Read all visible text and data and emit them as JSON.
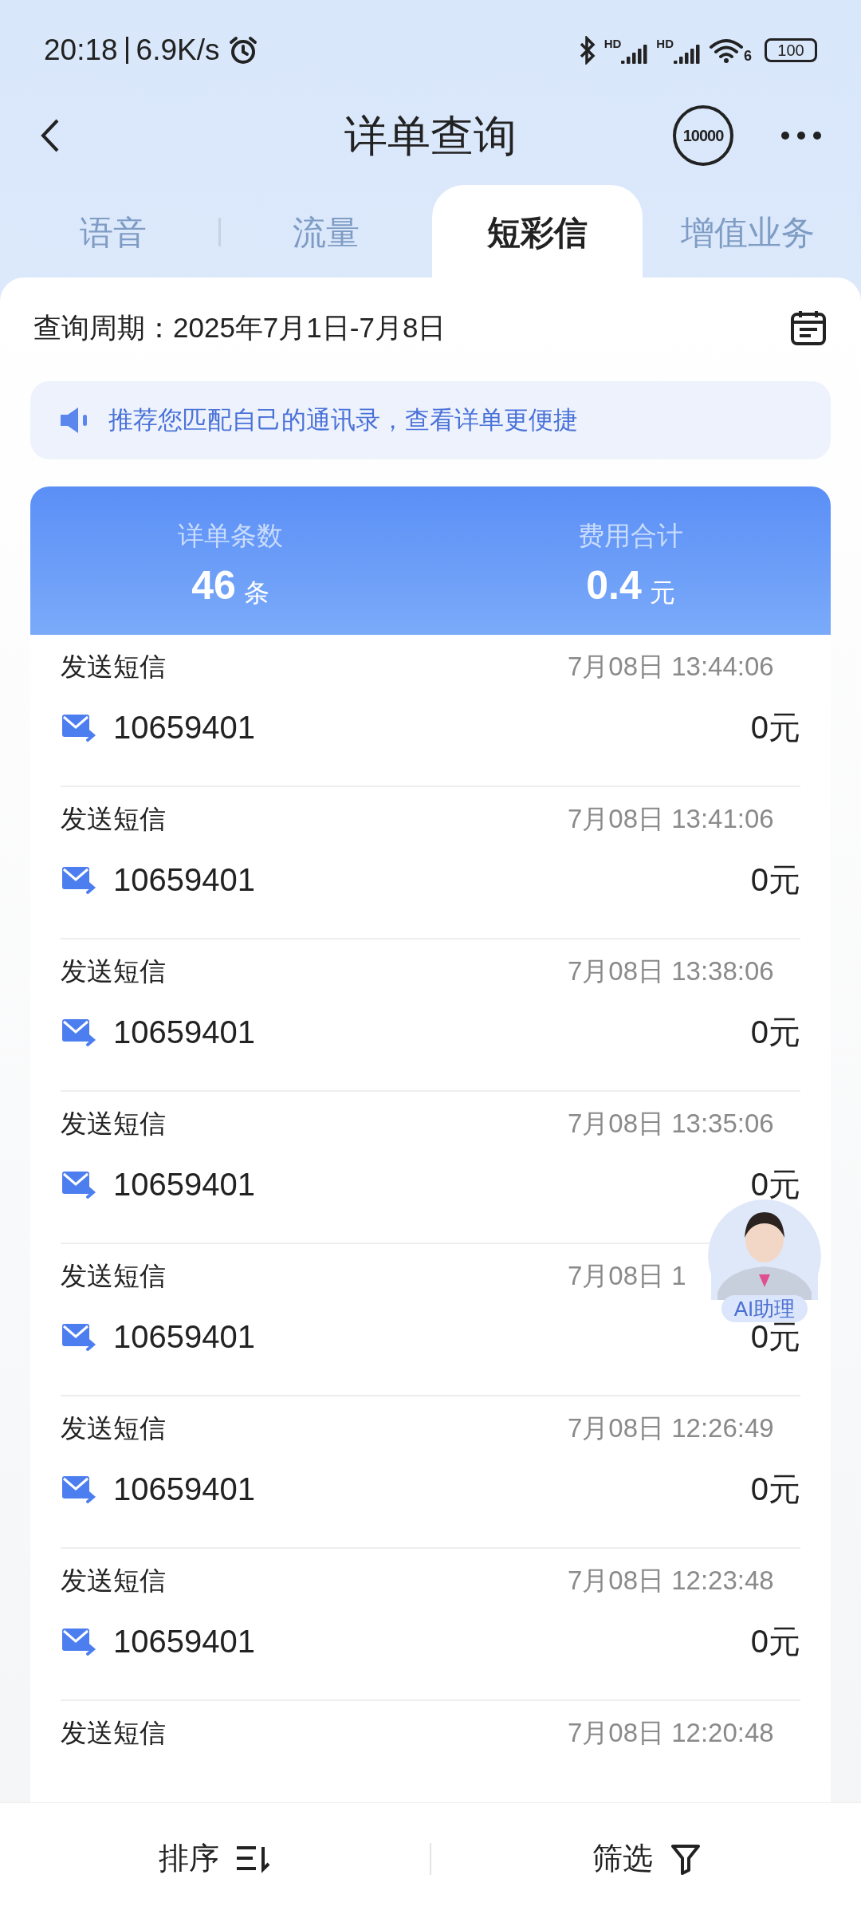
{
  "status_bar": {
    "time": "20:18",
    "speed": "6.9K/s",
    "network_labels": [
      "HD",
      "HD"
    ],
    "wifi_label": "6",
    "battery": "100"
  },
  "header": {
    "title": "详单查询",
    "service_badge": "10000"
  },
  "tabs": [
    {
      "label": "语音",
      "selected": false
    },
    {
      "label": "流量",
      "selected": false
    },
    {
      "label": "短彩信",
      "selected": true
    },
    {
      "label": "增值业务",
      "selected": false
    }
  ],
  "period": {
    "label": "查询周期：",
    "value": "2025年7月1日-7月8日"
  },
  "notice": "推荐您匹配自己的通讯录，查看详单更便捷",
  "summary": [
    {
      "label": "详单条数",
      "value": "46",
      "unit": "条"
    },
    {
      "label": "费用合计",
      "value": "0.4",
      "unit": "元"
    }
  ],
  "records": [
    {
      "type": "发送短信",
      "time": "7月08日 13:44:06",
      "number": "10659401",
      "fee": "0元"
    },
    {
      "type": "发送短信",
      "time": "7月08日 13:41:06",
      "number": "10659401",
      "fee": "0元"
    },
    {
      "type": "发送短信",
      "time": "7月08日 13:38:06",
      "number": "10659401",
      "fee": "0元"
    },
    {
      "type": "发送短信",
      "time": "7月08日 13:35:06",
      "number": "10659401",
      "fee": "0元"
    },
    {
      "type": "发送短信",
      "time": "7月08日 1",
      "number": "10659401",
      "fee": "0元"
    },
    {
      "type": "发送短信",
      "time": "7月08日 12:26:49",
      "number": "10659401",
      "fee": "0元"
    },
    {
      "type": "发送短信",
      "time": "7月08日 12:23:48",
      "number": "10659401",
      "fee": "0元"
    },
    {
      "type": "发送短信",
      "time": "7月08日 12:20:48"
    }
  ],
  "assistant": {
    "label": "AI助理"
  },
  "bottom_bar": {
    "sort": "排序",
    "filter": "筛选"
  }
}
